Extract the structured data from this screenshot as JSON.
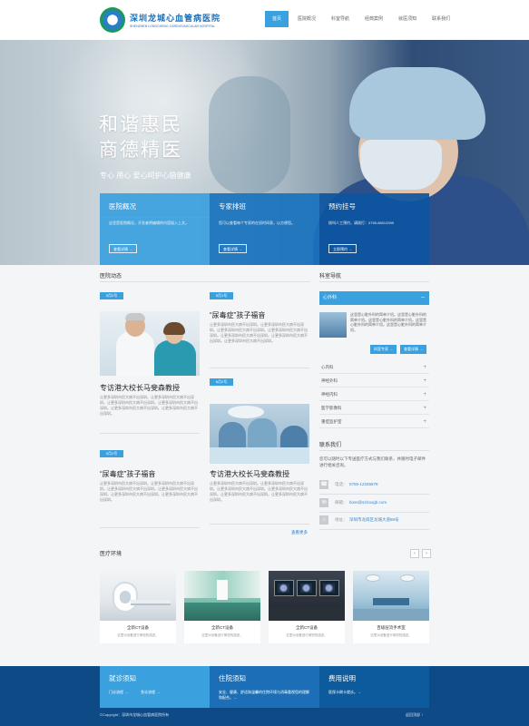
{
  "header": {
    "logo_cn": "深圳龙城心血管病医院",
    "logo_en": "SHENZHEN LONGCHENG CARDIOVASCULAR HOSPITAL",
    "nav": [
      "首页",
      "医院概况",
      "科室导航",
      "经典案例",
      "就医须知",
      "联系我们"
    ]
  },
  "hero": {
    "title_line1": "和谐惠民",
    "title_line2": "商德精医",
    "subtitle": "专心 用心 爱心呵护心脑健康",
    "cards": [
      {
        "title": "医院概况",
        "desc": "这里是医院概况，开发者将编辑的内容插入上文。",
        "button": "查看详情 →"
      },
      {
        "title": "专家排班",
        "desc": "您可以查看每个专家的在班时间表，以方便您。",
        "button": "查看详情 →"
      },
      {
        "title": "预约挂号",
        "desc": "拨叫人工预约，请拨打：0755-86913399",
        "button": "立即预约 →"
      }
    ]
  },
  "news": {
    "section_title": "医院动态",
    "more": "查看更多",
    "items": [
      {
        "date": "5月2号",
        "title": "专访港大校长马斐森教授",
        "body": "让更多深圳市民大病不出深圳。让更多深圳市民大病不出深圳。让更多深圳市民大病不出深圳。让更多深圳市民大病不出深圳。让更多深圳市民大病不出深圳。让更多深圳市民大病不出深圳。"
      },
      {
        "date": "5月1号",
        "title": "“尿毒症”孩子福音",
        "body": "让更多深圳市民大病不出深圳。让更多深圳市民大病不出深圳。让更多深圳市民大病不出深圳。让更多深圳市民大病不出深圳。让更多深圳市民大病不出深圳。让更多深圳市民大病不出深圳。让更多深圳市民大病不出深圳。"
      },
      {
        "date": "5月2号",
        "title": "“尿毒症”孩子福音",
        "body": "让更多深圳市民大病不出深圳。让更多深圳市民大病不出深圳。让更多深圳市民大病不出深圳。让更多深圳市民大病不出深圳。让更多深圳市民大病不出深圳。让更多深圳市民大病不出深圳。"
      },
      {
        "date": "6月2号",
        "title": "专访港大校长马斐森教授",
        "body": "让更多深圳市民大病不出深圳。让更多深圳市民大病不出深圳。让更多深圳市民大病不出深圳。让更多深圳市民大病不出深圳。让更多深圳市民大病不出深圳。让更多深圳市民大病不出深圳。"
      }
    ]
  },
  "departments": {
    "section_title": "科室导航",
    "active": "心外科",
    "active_desc": "这里是心脏外科的简单介绍。这里是心脏外科的简单介绍。这里是心脏外科的简单介绍。这里是心脏外科的简单介绍。这里是心脏外科的简单介绍。",
    "btn_expert": "科室专家 →",
    "btn_detail": "查看详情 →",
    "list": [
      "心内科",
      "神经外科",
      "神经内科",
      "医学影像科",
      "重症监护室"
    ]
  },
  "contact": {
    "section_title": "联系我们",
    "intro": "您可以随时以下专送医疗方式与我们联系，并随时电子邮件进行相关咨询。",
    "phone_label": "电话：",
    "phone": "0755-12345678",
    "email_label": "邮箱：",
    "email": "boss@szlcxxgb.com",
    "address_label": "地址：",
    "address": "深圳市龙岗区龙城大道88号"
  },
  "environment": {
    "section_title": "医疗环境",
    "prev": "‹",
    "next": "›",
    "items": [
      {
        "title": "全新CT设备",
        "desc": "这里对设备进行简短的描述。"
      },
      {
        "title": "全新CT设备",
        "desc": "这里对设备进行简短的描述。"
      },
      {
        "title": "全新CT设备",
        "desc": "这里对设备进行简短的描述。"
      },
      {
        "title": "百级层流手术室",
        "desc": "这里对设备进行简短的描述。"
      }
    ]
  },
  "footer": {
    "cols": [
      {
        "title": "就诊须知",
        "links": [
          "门诊流程 →",
          "急诊流程 →"
        ]
      },
      {
        "title": "住院须知",
        "text": "安全、健康、舒适和温馨的住院环境与消毒重视您的理解和配合。→"
      },
      {
        "title": "费用说明",
        "text": "医保卡刷卡就诊。→"
      }
    ],
    "copyright": "©Copyright：深圳市龙城心血管病医院所有",
    "back_top": "返回顶部 ↑"
  },
  "colors": {
    "accent": "#3ba0de",
    "mid_blue": "#1872bd",
    "dark_blue": "#0d5a9d",
    "footer": "#0d4a86"
  }
}
